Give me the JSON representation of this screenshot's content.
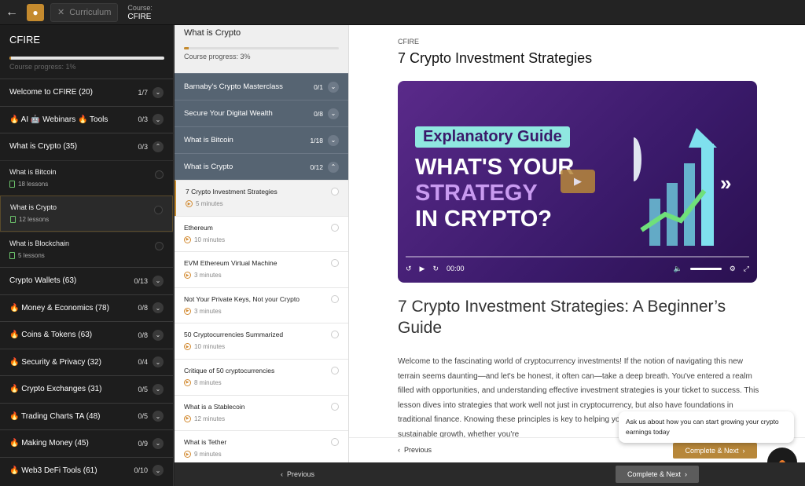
{
  "topbar": {
    "back_icon": "arrow-left-icon",
    "curriculum_label": "Curriculum",
    "course_small": "Course:",
    "course_name": "CFIRE"
  },
  "sidebar": {
    "title": "CFIRE",
    "progress_fraction": 0.01,
    "progress_text": "Course progress: 1%",
    "sections": [
      {
        "label": "Welcome to CFIRE (20)",
        "count": "1/7",
        "open": false
      },
      {
        "label": "🔥 AI 🤖 Webinars 🔥 Tools",
        "count": "0/3",
        "open": false
      },
      {
        "label": "What is Crypto (35)",
        "count": "0/3",
        "open": true
      }
    ],
    "subs": [
      {
        "name": "What is Bitcoin",
        "lessons": "18 lessons"
      },
      {
        "name": "What is Crypto",
        "lessons": "12 lessons"
      },
      {
        "name": "What is Blockchain",
        "lessons": "5 lessons"
      }
    ],
    "sections_after": [
      {
        "label": "Crypto Wallets (63)",
        "count": "0/13"
      },
      {
        "label": "🔥 Money & Economics (78)",
        "count": "0/8"
      },
      {
        "label": "🔥 Coins & Tokens (63)",
        "count": "0/8"
      },
      {
        "label": "🔥 Security & Privacy (32)",
        "count": "0/4"
      },
      {
        "label": "🔥 Crypto Exchanges (31)",
        "count": "0/5"
      },
      {
        "label": "🔥 Trading Charts TA (48)",
        "count": "0/5"
      },
      {
        "label": "🔥 Making Money (45)",
        "count": "0/9"
      },
      {
        "label": "🔥 Web3 DeFi Tools (61)",
        "count": "0/10"
      }
    ]
  },
  "mid": {
    "title": "What is Crypto",
    "progress_fraction": 0.03,
    "progress_text": "Course progress: 3%",
    "sections": [
      {
        "label": "Barnaby's Crypto Masterclass",
        "count": "0/1"
      },
      {
        "label": "Secure Your Digital Wealth",
        "count": "0/8"
      },
      {
        "label": "What is Bitcoin",
        "count": "1/18"
      },
      {
        "label": "What is Crypto",
        "count": "0/12"
      }
    ],
    "lessons": [
      {
        "name": "7 Crypto Investment Strategies",
        "dur": "5 minutes"
      },
      {
        "name": "Ethereum",
        "dur": "10 minutes"
      },
      {
        "name": "EVM Ethereum Virtual Machine",
        "dur": "3 minutes"
      },
      {
        "name": "Not Your Private Keys, Not your Crypto",
        "dur": "3 minutes"
      },
      {
        "name": "50 Cryptocurrencies Summarized",
        "dur": "10 minutes"
      },
      {
        "name": "Critique of 50 cryptocurrencies",
        "dur": "8 minutes"
      },
      {
        "name": "What is a Stablecoin",
        "dur": "12 minutes"
      },
      {
        "name": "What is Tether",
        "dur": "9 minutes"
      }
    ]
  },
  "main": {
    "eyebrow": "CFIRE",
    "title": "7 Crypto Investment Strategies",
    "video": {
      "guide": "Explanatory Guide",
      "line1": "WHAT'S YOUR",
      "line2": "STRATEGY",
      "line3": "IN CRYPTO?",
      "time": "00:00"
    },
    "heading": "7 Crypto Investment Strategies: A Beginner’s Guide",
    "paragraph": "Welcome to the fascinating world of cryptocurrency investments! If the notion of navigating this new terrain seems daunting—and let's be honest, it often can—take a deep breath. You've entered a realm filled with opportunities, and understanding effective investment strategies is your ticket to success. This lesson dives into strategies that work well not just in cryptocurrency, but also have foundations in traditional finance. Knowing these principles is key to helping you mitigate risks and promote sustainable growth, whether you're",
    "prev_label": "Previous",
    "complete_label": "Complete & Next"
  },
  "chat": {
    "text": "Ask us about how you can start growing your crypto earnings today"
  },
  "bottom": {
    "prev_label": "Previous",
    "complete_label": "Complete & Next"
  }
}
